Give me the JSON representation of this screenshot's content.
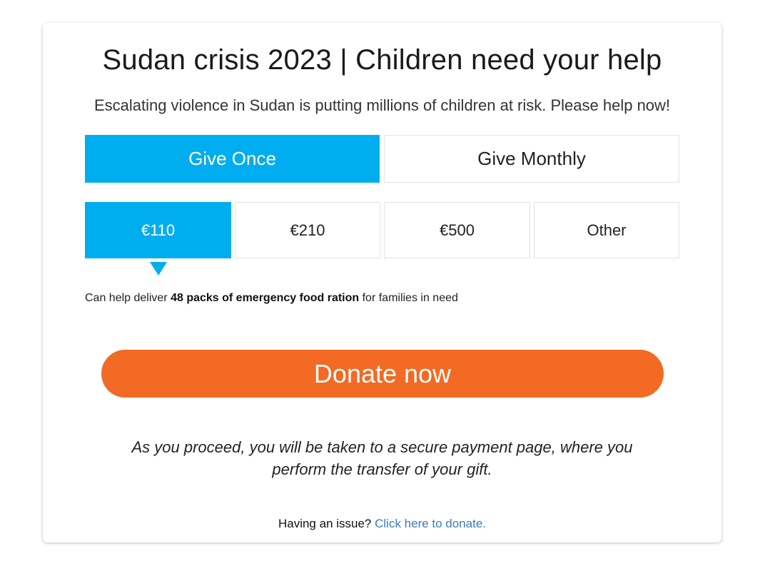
{
  "header": {
    "title": "Sudan crisis 2023 | Children need your help",
    "subtitle": "Escalating violence in Sudan is putting millions of children at risk. Please help now!"
  },
  "frequency": {
    "once_label": "Give Once",
    "monthly_label": "Give Monthly",
    "selected": "Give Once"
  },
  "amounts": {
    "options": [
      "€110",
      "€210",
      "€500",
      "Other"
    ],
    "selected": "€110"
  },
  "impact": {
    "prefix": "Can help deliver ",
    "highlight": "48 packs of emergency food ration",
    "suffix": " for families in need"
  },
  "donate_button": "Donate now",
  "note": "As you proceed, you will be taken to a secure payment page, where you perform the transfer of your gift.",
  "issue": {
    "text": "Having an issue? ",
    "link": "Click here to donate."
  },
  "colors": {
    "accent": "#00aeef",
    "donate": "#f26a24",
    "link": "#3a7bbf"
  }
}
